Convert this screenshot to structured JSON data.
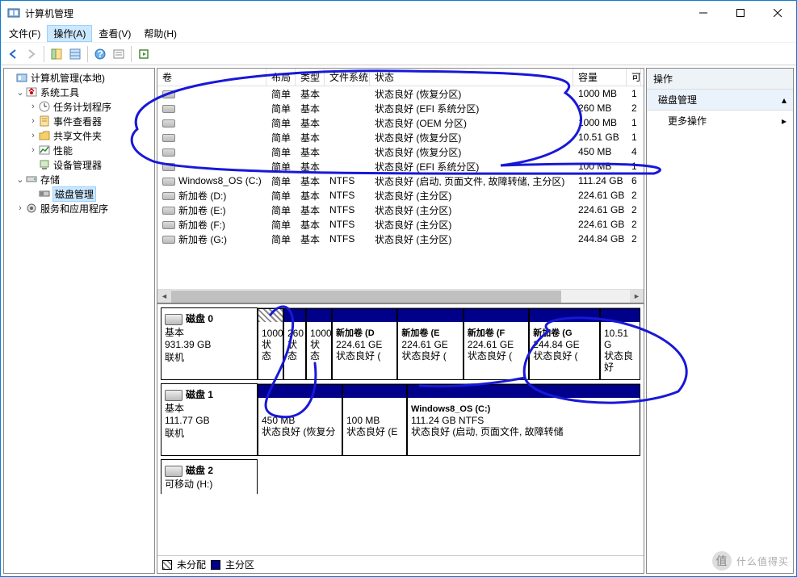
{
  "window": {
    "title": "计算机管理"
  },
  "menu": {
    "file": "文件(F)",
    "action": "操作(A)",
    "view": "查看(V)",
    "help": "帮助(H)"
  },
  "tree": {
    "root": "计算机管理(本地)",
    "sys": "系统工具",
    "sched": "任务计划程序",
    "event": "事件查看器",
    "share": "共享文件夹",
    "perf": "性能",
    "devmgr": "设备管理器",
    "storage": "存储",
    "diskmgmt": "磁盘管理",
    "services": "服务和应用程序"
  },
  "table": {
    "headers": {
      "vol": "卷",
      "layout": "布局",
      "type": "类型",
      "fs": "文件系统",
      "status": "状态",
      "cap": "容量",
      "free": "可"
    },
    "rows": [
      {
        "vol": "",
        "layout": "简单",
        "type": "基本",
        "fs": "",
        "status": "状态良好 (恢复分区)",
        "cap": "1000 MB",
        "free": "1"
      },
      {
        "vol": "",
        "layout": "简单",
        "type": "基本",
        "fs": "",
        "status": "状态良好 (EFI 系统分区)",
        "cap": "260 MB",
        "free": "2"
      },
      {
        "vol": "",
        "layout": "简单",
        "type": "基本",
        "fs": "",
        "status": "状态良好 (OEM 分区)",
        "cap": "1000 MB",
        "free": "1"
      },
      {
        "vol": "",
        "layout": "简单",
        "type": "基本",
        "fs": "",
        "status": "状态良好 (恢复分区)",
        "cap": "10.51 GB",
        "free": "1"
      },
      {
        "vol": "",
        "layout": "简单",
        "type": "基本",
        "fs": "",
        "status": "状态良好 (恢复分区)",
        "cap": "450 MB",
        "free": "4"
      },
      {
        "vol": "",
        "layout": "简单",
        "type": "基本",
        "fs": "",
        "status": "状态良好 (EFI 系统分区)",
        "cap": "100 MB",
        "free": "1"
      },
      {
        "vol": "Windows8_OS (C:)",
        "layout": "简单",
        "type": "基本",
        "fs": "NTFS",
        "status": "状态良好 (启动, 页面文件, 故障转储, 主分区)",
        "cap": "111.24 GB",
        "free": "6"
      },
      {
        "vol": "新加卷 (D:)",
        "layout": "简单",
        "type": "基本",
        "fs": "NTFS",
        "status": "状态良好 (主分区)",
        "cap": "224.61 GB",
        "free": "2"
      },
      {
        "vol": "新加卷 (E:)",
        "layout": "简单",
        "type": "基本",
        "fs": "NTFS",
        "status": "状态良好 (主分区)",
        "cap": "224.61 GB",
        "free": "2"
      },
      {
        "vol": "新加卷 (F:)",
        "layout": "简单",
        "type": "基本",
        "fs": "NTFS",
        "status": "状态良好 (主分区)",
        "cap": "224.61 GB",
        "free": "2"
      },
      {
        "vol": "新加卷 (G:)",
        "layout": "简单",
        "type": "基本",
        "fs": "NTFS",
        "status": "状态良好 (主分区)",
        "cap": "244.84 GB",
        "free": "2"
      }
    ]
  },
  "disks": {
    "d0": {
      "name": "磁盘 0",
      "type": "基本",
      "size": "931.39 GB",
      "status": "联机",
      "p0": {
        "title": "",
        "l1": "1000",
        "l2": "状态"
      },
      "p1": {
        "title": "",
        "l1": "260",
        "l2": "状态"
      },
      "p2": {
        "title": "",
        "l1": "1000",
        "l2": "状态"
      },
      "p3": {
        "title": "新加卷  (D",
        "l1": "224.61 GE",
        "l2": "状态良好 ("
      },
      "p4": {
        "title": "新加卷  (E",
        "l1": "224.61 GE",
        "l2": "状态良好 ("
      },
      "p5": {
        "title": "新加卷  (F",
        "l1": "224.61 GE",
        "l2": "状态良好 ("
      },
      "p6": {
        "title": "新加卷  (G",
        "l1": "244.84 GE",
        "l2": "状态良好 ("
      },
      "p7": {
        "title": "",
        "l1": "10.51 G",
        "l2": "状态良好"
      }
    },
    "d1": {
      "name": "磁盘 1",
      "type": "基本",
      "size": "111.77 GB",
      "status": "联机",
      "p0": {
        "title": "",
        "l1": "450 MB",
        "l2": "状态良好 (恢复分"
      },
      "p1": {
        "title": "",
        "l1": "100 MB",
        "l2": "状态良好 (E"
      },
      "p2": {
        "title": "Windows8_OS  (C:)",
        "l1": "111.24 GB NTFS",
        "l2": "状态良好 (启动, 页面文件, 故障转储"
      }
    },
    "d2": {
      "name": "磁盘 2",
      "type": "可移动 (H:)"
    }
  },
  "legend": {
    "unalloc": "未分配",
    "primary": "主分区"
  },
  "actions": {
    "header": "操作",
    "group": "磁盘管理",
    "more": "更多操作"
  },
  "watermark": "什么值得买"
}
